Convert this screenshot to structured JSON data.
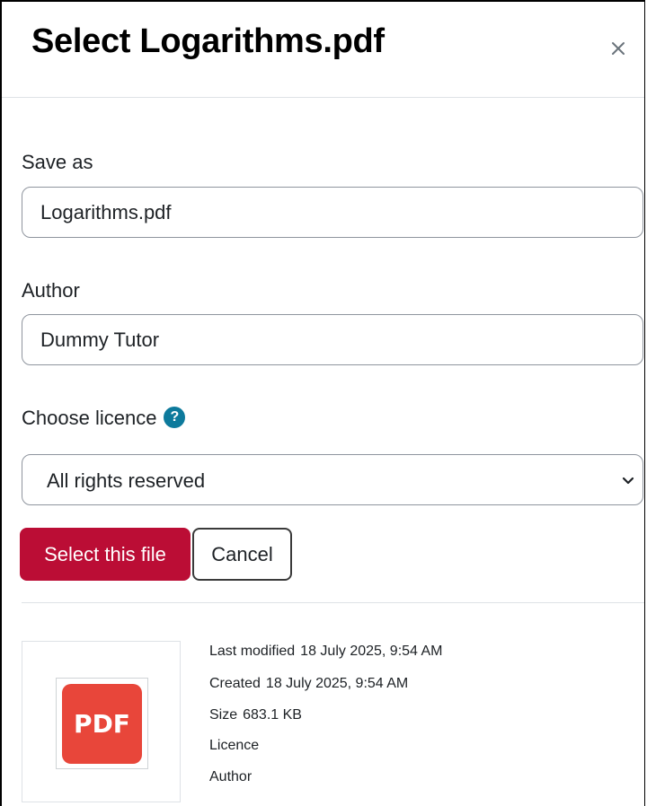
{
  "dialog": {
    "title": "Select Logarithms.pdf",
    "close_icon": "close-icon",
    "close_glyph": "×"
  },
  "form": {
    "save_as": {
      "label": "Save as",
      "value": "Logarithms.pdf"
    },
    "author": {
      "label": "Author",
      "value": "Dummy Tutor"
    },
    "licence": {
      "label": "Choose licence",
      "help_icon": "question-icon",
      "help_glyph": "?",
      "selected": "All rights reserved"
    }
  },
  "buttons": {
    "select_label": "Select this file",
    "cancel_label": "Cancel"
  },
  "file_info": {
    "thumbnail_icon": "pdf-file-icon",
    "thumbnail_text": "PDF",
    "last_modified_label": "Last modified",
    "last_modified_value": "18 July 2025, 9:54 AM",
    "created_label": "Created",
    "created_value": "18 July 2025, 9:54 AM",
    "size_label": "Size",
    "size_value": "683.1 KB",
    "licence_label": "Licence",
    "author_label": "Author"
  },
  "colors": {
    "primary": "#bb0d35",
    "help_icon": "#0d7a9c",
    "pdf_icon": "#e8463a",
    "border": "#8f959e"
  }
}
